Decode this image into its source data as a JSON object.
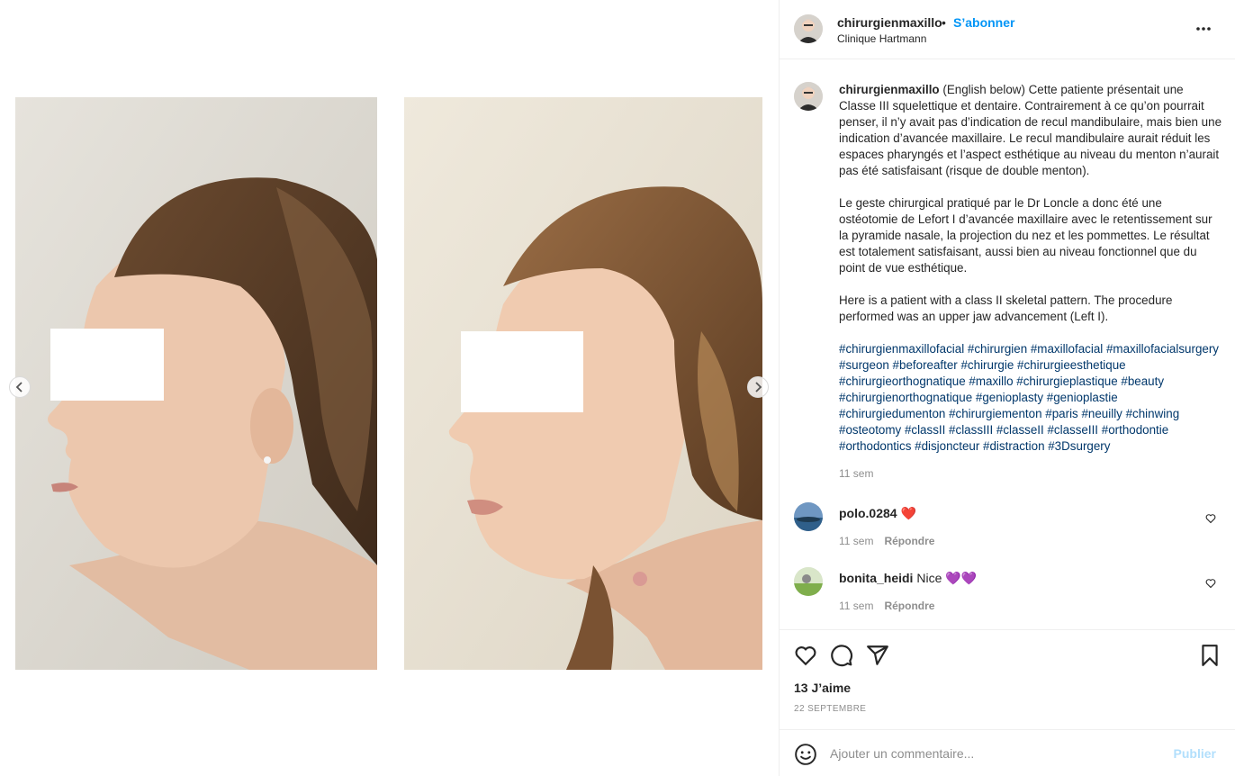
{
  "post": {
    "username": "chirurgienmaxillo",
    "separator": "•",
    "follow_label": "S’abonner",
    "location": "Clinique Hartmann",
    "more_icon": "more-options-icon"
  },
  "caption": {
    "username": "chirurgienmaxillo",
    "paragraph1": "(English below) Cette patiente présentait une Classe III squelettique et dentaire. Contrairement à ce qu’on pourrait penser, il n’y avait pas d’indication de recul mandibulaire, mais bien une indication d’avancée maxillaire. Le recul mandibulaire aurait réduit les espaces pharyngés et l’aspect esthétique au niveau du menton n’aurait pas été satisfaisant (risque de double menton).",
    "paragraph2": "Le geste chirurgical pratiqué par le Dr Loncle a donc été une ostéotomie de Lefort I d’avancée maxillaire avec le retentissement sur la pyramide nasale, la projection du nez et les pommettes. Le résultat est totalement satisfaisant, aussi bien au niveau fonctionnel que du point de vue esthétique.",
    "paragraph3": "Here is a patient with a class II skeletal pattern. The procedure performed was an upper jaw advancement (Left I).",
    "hashtags": "#chirurgienmaxillofacial #chirurgien #maxillofacial #maxillofacialsurgery #surgeon #beforeafter #chirurgie #chirurgieesthetique #chirurgieorthognatique #maxillo #chirurgieplastique #beauty #chirurgienorthognatique #genioplasty #genioplastie #chirurgiedumenton #chirurgiementon #paris #neuilly #chinwing #osteotomy #classII #classIII #classeII #classeIII #orthodontie #orthodontics #disjoncteur #distraction #3Dsurgery",
    "time": "11 sem"
  },
  "comments": [
    {
      "user": "polo.0284",
      "text": "❤️",
      "time": "11 sem",
      "reply": "Répondre"
    },
    {
      "user": "bonita_heidi",
      "text": "Nice 💜💜",
      "time": "11 sem",
      "reply": "Répondre"
    }
  ],
  "actions": {
    "likes": "13 J’aime",
    "date": "22 SEPTEMBRE"
  },
  "composer": {
    "placeholder": "Ajouter un commentaire...",
    "publish_label": "Publier"
  },
  "colors": {
    "accent": "#0095f6",
    "hashtag": "#00376b",
    "muted": "#8e8e8e",
    "publish_disabled": "#b2dffc",
    "heart": "#ed4956",
    "purple_heart": "#8a5cf5"
  }
}
